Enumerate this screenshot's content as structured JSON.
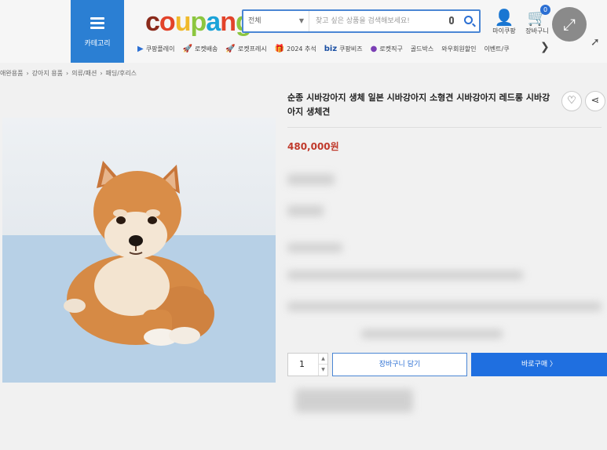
{
  "header": {
    "category_label": "카테고리",
    "logo": "coupang",
    "search": {
      "category": "전체",
      "placeholder": "찾고 싶은 상품을 검색해보세요!"
    },
    "my_coupang": "마이쿠팡",
    "cart": "장바구니",
    "cart_count": "0"
  },
  "quick_links": [
    {
      "icon": "▶",
      "label": "쿠팡플레이",
      "color": "#2b6fd3"
    },
    {
      "icon": "🚀",
      "label": "로켓배송",
      "color": "#2b6fd3"
    },
    {
      "icon": "🚀",
      "label": "로켓프레시",
      "color": "#2e9b3a"
    },
    {
      "icon": "🎁",
      "label": "2024 추석",
      "color": "#b5651d"
    },
    {
      "icon": "biz",
      "label": "쿠팡비즈",
      "color": "#1a4fa3"
    },
    {
      "icon": "●",
      "label": "로켓직구",
      "color": "#7b3fb5"
    },
    {
      "icon": "",
      "label": "골드박스",
      "color": "#444"
    },
    {
      "icon": "",
      "label": "와우회원할인",
      "color": "#444"
    },
    {
      "icon": "",
      "label": "이벤트/쿠",
      "color": "#444"
    }
  ],
  "breadcrumb": [
    "애완용품",
    "강아지 용품",
    "의류/패션",
    "패딩/후리스"
  ],
  "product": {
    "title": "순종 시바강아지 생체 일본 시바강아지 소형견 시바강아지 레드롱 시바강아지 생체견",
    "price": "480,000원",
    "quantity": "1",
    "cart_button": "장바구니 담기",
    "buy_button": "바로구매 〉"
  },
  "icons": {
    "menu": "menu-icon",
    "heart": "heart-icon",
    "share": "share-icon",
    "expand": "expand-icon"
  }
}
